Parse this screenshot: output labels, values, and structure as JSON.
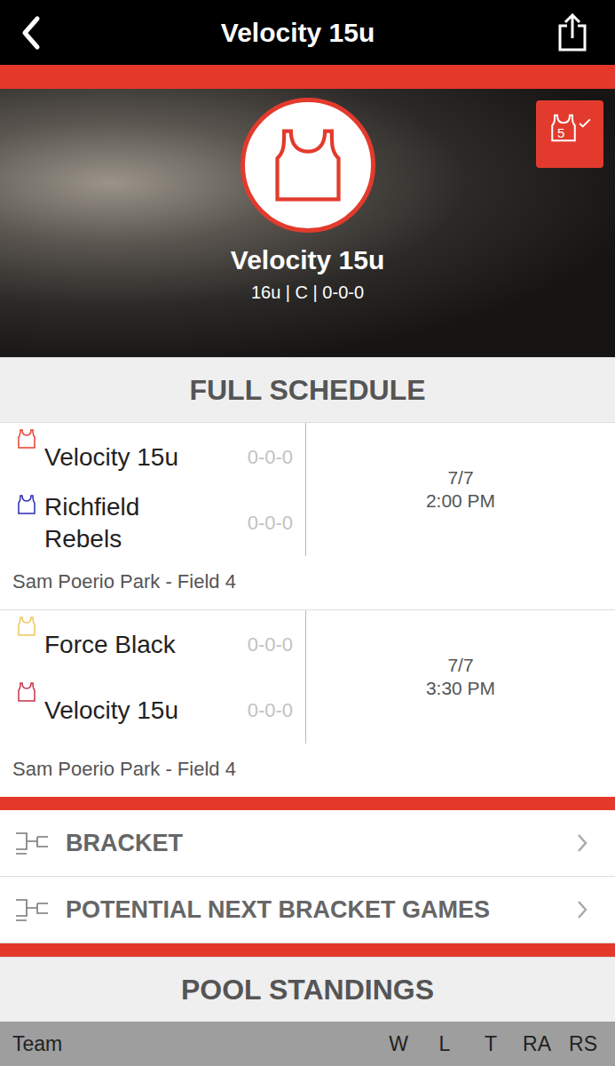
{
  "header": {
    "title": "Velocity 15u"
  },
  "team": {
    "name": "Velocity 15u",
    "subtitle": "16u | C | 0-0-0",
    "badge": "5"
  },
  "schedule": {
    "title": "FULL SCHEDULE",
    "games": [
      {
        "teams": [
          {
            "name": "Velocity 15u",
            "record": "0-0-0",
            "color": "#e4402f"
          },
          {
            "name": "Richfield Rebels",
            "record": "0-0-0",
            "color": "#2b2bb0"
          }
        ],
        "date": "7/7",
        "time": "2:00 PM",
        "location": "Sam Poerio Park - Field 4"
      },
      {
        "teams": [
          {
            "name": "Force Black",
            "record": "0-0-0",
            "color": "#efc75e"
          },
          {
            "name": "Velocity 15u",
            "record": "0-0-0",
            "color": "#c8324a"
          }
        ],
        "date": "7/7",
        "time": "3:30 PM",
        "location": "Sam Poerio Park - Field 4"
      }
    ]
  },
  "links": [
    {
      "label": "BRACKET"
    },
    {
      "label": "POTENTIAL NEXT BRACKET GAMES"
    }
  ],
  "standings": {
    "title": "POOL STANDINGS",
    "columns": [
      "Team",
      "W",
      "L",
      "T",
      "RA",
      "RS"
    ]
  }
}
